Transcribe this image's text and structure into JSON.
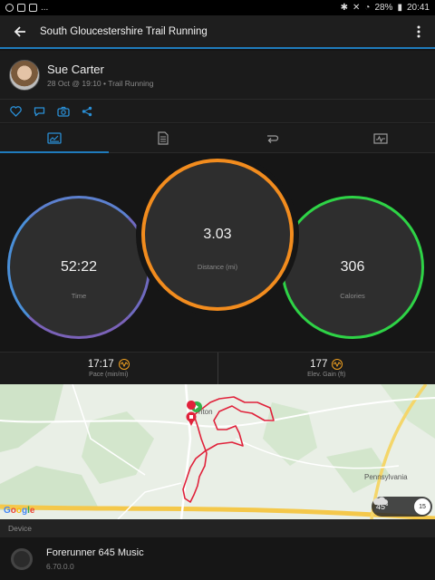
{
  "status_bar": {
    "left_icons": [
      "alert-icon",
      "instagram-icon",
      "instagram-icon"
    ],
    "left_more": "...",
    "battery": "28%",
    "time": "20:41"
  },
  "header": {
    "title": "South Gloucestershire Trail Running"
  },
  "user": {
    "name": "Sue Carter",
    "meta": "28 Oct @ 19:10 • Trail Running"
  },
  "actions": [
    "heart-icon",
    "comment-icon",
    "camera-icon",
    "share-icon"
  ],
  "tabs": [
    "overview-icon",
    "details-icon",
    "laps-icon",
    "chart-icon"
  ],
  "stats": {
    "time": {
      "value": "52:22",
      "label": "Time"
    },
    "distance": {
      "value": "3.03",
      "label": "Distance (mi)"
    },
    "calories": {
      "value": "306",
      "label": "Calories"
    }
  },
  "metrics": {
    "pace": {
      "value": "17:17",
      "label": "Pace (min/mi)"
    },
    "elevation": {
      "value": "177",
      "label": "Elev. Gain (ft)"
    }
  },
  "map": {
    "place_labels": [
      "nton",
      "Pennsylvania"
    ],
    "attribution": "Google",
    "weather_temp": "45°",
    "weather_badge": "15"
  },
  "device": {
    "section_title": "Device",
    "name": "Forerunner 645 Music",
    "version": "6.70.0.0"
  },
  "colors": {
    "accent": "#1f7bbd",
    "time_ring": "#4a8fd8",
    "distance_ring": "#f28c1e",
    "calories_ring": "#2ed346",
    "route": "#e0213a"
  }
}
